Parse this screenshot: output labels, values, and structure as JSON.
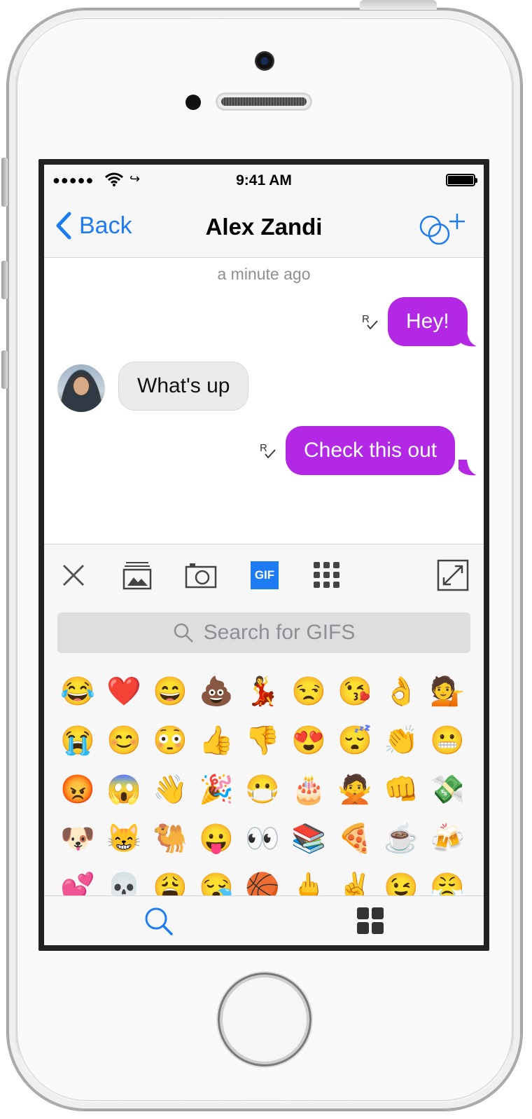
{
  "status_bar": {
    "signal": "●●●●●",
    "carrier_glyph": "↪",
    "time": "9:41 AM"
  },
  "nav": {
    "back_label": "Back",
    "title": "Alex Zandi"
  },
  "chat": {
    "timestamp": "a minute ago",
    "messages": [
      {
        "direction": "out",
        "text": "Hey!",
        "read_receipt": "R✓"
      },
      {
        "direction": "in",
        "text": "What's up"
      },
      {
        "direction": "out",
        "text": "Check this out",
        "read_receipt": "R✓"
      }
    ]
  },
  "toolbar": {
    "items": [
      "close-icon",
      "gallery-icon",
      "camera-icon",
      "gif-icon",
      "apps-grid-icon",
      "expand-icon"
    ],
    "gif_label": "GIF"
  },
  "gif_search": {
    "placeholder": "Search for GIFS"
  },
  "emoji_rows": [
    [
      "😂",
      "❤️",
      "😄",
      "💩",
      "💃",
      "😒",
      "😘",
      "👌",
      "💁"
    ],
    [
      "😭",
      "😊",
      "😳",
      "👍",
      "👎",
      "😍",
      "😴",
      "👏",
      "😬"
    ],
    [
      "😡",
      "😱",
      "👋",
      "🎉",
      "😷",
      "🎂",
      "🙅",
      "👊",
      "💸"
    ],
    [
      "🐶",
      "😸",
      "🐫",
      "😛",
      "👀",
      "📚",
      "🍕",
      "☕",
      "🍻"
    ],
    [
      "💕",
      "💀",
      "😩",
      "😪",
      "🏀",
      "🖕",
      "✌️",
      "😉",
      "😤"
    ]
  ],
  "tab_bar": {
    "items": [
      "search-tab",
      "grid-tab"
    ]
  },
  "colors": {
    "accent_blue": "#1e7cf2",
    "outgoing_bubble": "#b228e4",
    "incoming_bubble": "#ebebed",
    "gif_button": "#1e7cf2"
  }
}
